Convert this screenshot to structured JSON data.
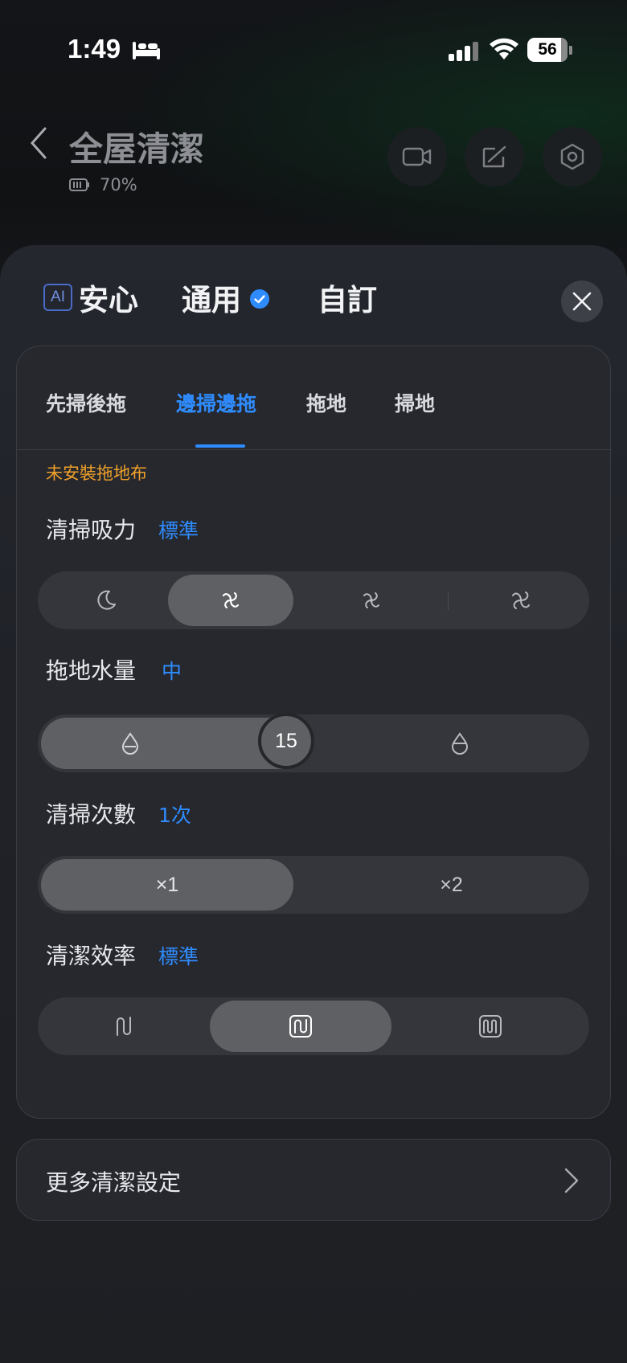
{
  "status_bar": {
    "time": "1:49",
    "battery": "56"
  },
  "header": {
    "title": "全屋清潔",
    "battery_percent": "70%"
  },
  "modes": {
    "ai_badge": "AI",
    "ai_safe": "安心",
    "general": "通用",
    "custom": "自訂"
  },
  "subtabs": [
    "先掃後拖",
    "邊掃邊拖",
    "拖地",
    "掃地"
  ],
  "active_subtab": 1,
  "warning": "未安裝拖地布",
  "suction": {
    "label": "清掃吸力",
    "value": "標準",
    "selected": 1
  },
  "water": {
    "label": "拖地水量",
    "value": "中",
    "slider_value": "15",
    "level": 0.5
  },
  "passes": {
    "label": "清掃次數",
    "value": "1次",
    "options": [
      "×1",
      "×2"
    ],
    "selected": 0
  },
  "efficiency": {
    "label": "清潔效率",
    "value": "標準",
    "selected": 1
  },
  "more": {
    "label": "更多清潔設定"
  },
  "colors": {
    "accent": "#2f8cff",
    "warning": "#f0a12a",
    "selected": "#5f6063"
  }
}
